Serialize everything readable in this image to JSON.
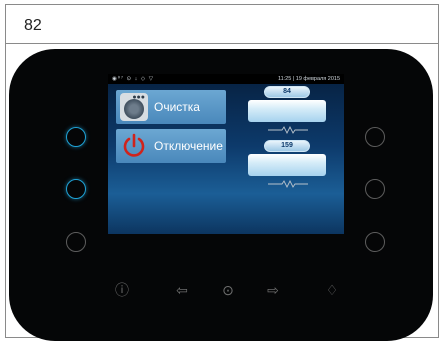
{
  "figure": {
    "number": "82"
  },
  "screen": {
    "status": {
      "icons": "◉⁰⁷ ⊙ ↓ ◇ ▽",
      "time": "11:25 | 19 февраля 2015"
    },
    "menu": [
      {
        "label": "Очистка",
        "icon": "cleaning-icon"
      },
      {
        "label": "Отключение",
        "icon": "power-icon"
      }
    ],
    "panels": [
      {
        "value": "84"
      },
      {
        "value": "159"
      }
    ]
  },
  "bottom_controls": [
    {
      "name": "info-button",
      "glyph": "ⓘ"
    },
    {
      "name": "arrow-left-button",
      "glyph": "⇦"
    },
    {
      "name": "more-button",
      "glyph": "⊙"
    },
    {
      "name": "arrow-right-button",
      "glyph": "⇨"
    },
    {
      "name": "water-drop-button",
      "glyph": "♢"
    }
  ],
  "colors": {
    "accent_ring": "#1fa4d8",
    "power_red": "#d0231c",
    "menu_blue": "#5a97c6"
  }
}
